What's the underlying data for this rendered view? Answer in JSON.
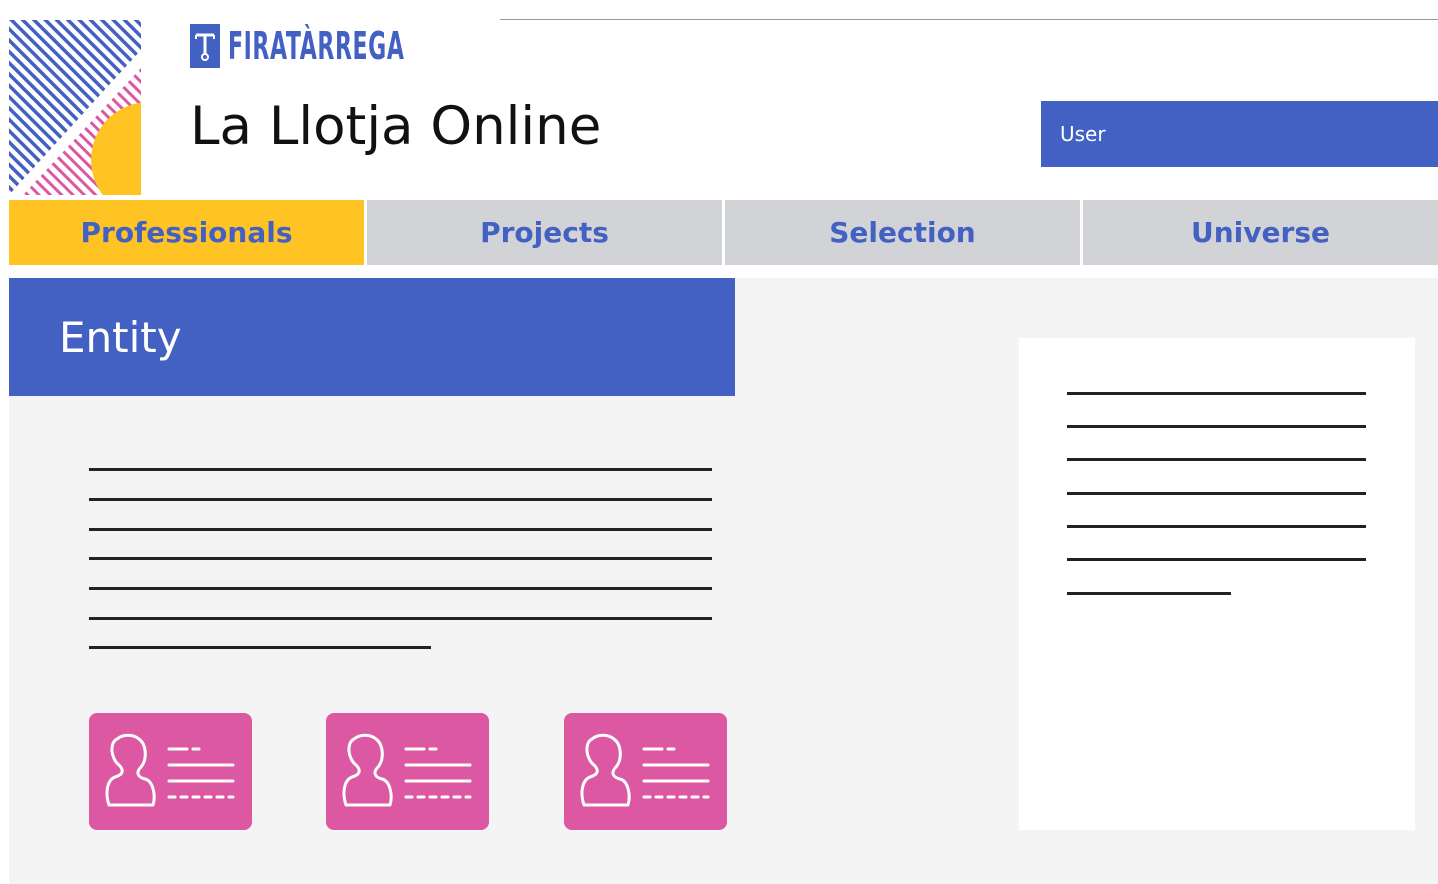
{
  "brand": {
    "logo_text": "FIRATÀRREGA",
    "app_title": "La Llotja Online",
    "primary_color": "#4360c3",
    "accent_color": "#ffc324",
    "card_color": "#dc58a3"
  },
  "user": {
    "label": "User"
  },
  "tabs": [
    {
      "label": "Professionals",
      "active": true
    },
    {
      "label": "Projects",
      "active": false
    },
    {
      "label": "Selection",
      "active": false
    },
    {
      "label": "Universe",
      "active": false
    }
  ],
  "entity": {
    "title": "Entity",
    "cards": [
      {
        "icon": "profile-card-icon"
      },
      {
        "icon": "profile-card-icon"
      },
      {
        "icon": "profile-card-icon"
      }
    ]
  }
}
